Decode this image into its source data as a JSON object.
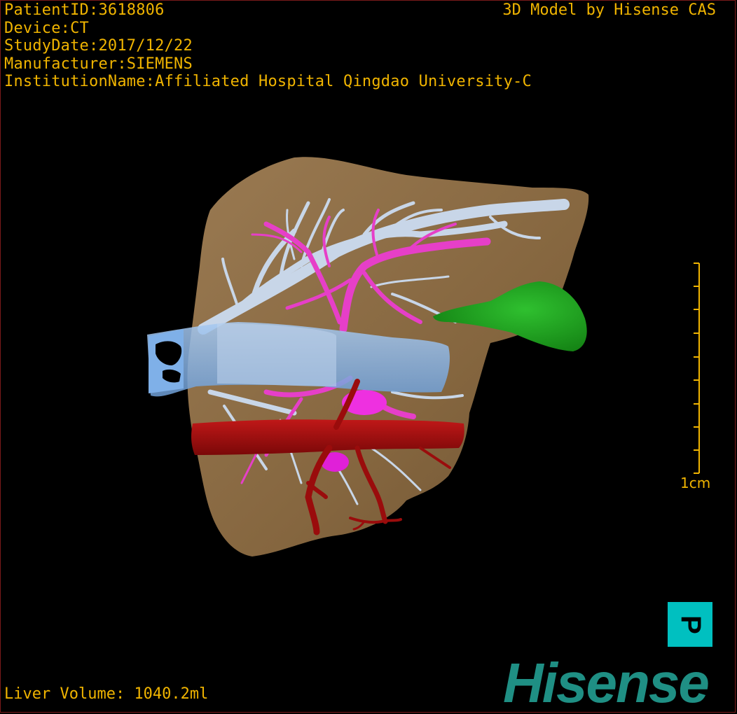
{
  "overlay": {
    "patient_id": "PatientID:3618806",
    "device": "Device:CT",
    "study_date": "StudyDate:2017/12/22",
    "manufacturer": "Manufacturer:SIEMENS",
    "institution": "InstitutionName:Affiliated Hospital Qingdao University-C",
    "credit": "3D Model by Hisense CAS",
    "liver_volume": "Liver Volume: 1040.2ml"
  },
  "scale_bar": {
    "label": "1cm"
  },
  "orientation": {
    "label": "P"
  },
  "brand": {
    "name": "Hisense"
  },
  "colors": {
    "overlay_text": "#f0b400",
    "liver": "#8a6a45",
    "hepatic_vein": "#c8d6e8",
    "portal_vein": "#e63fc8",
    "ivc": "#7fb0e8",
    "artery": "#a01010",
    "gallbladder": "#1fa01f",
    "brand": "#1f8f84",
    "orientation_box": "#00c0c0"
  }
}
